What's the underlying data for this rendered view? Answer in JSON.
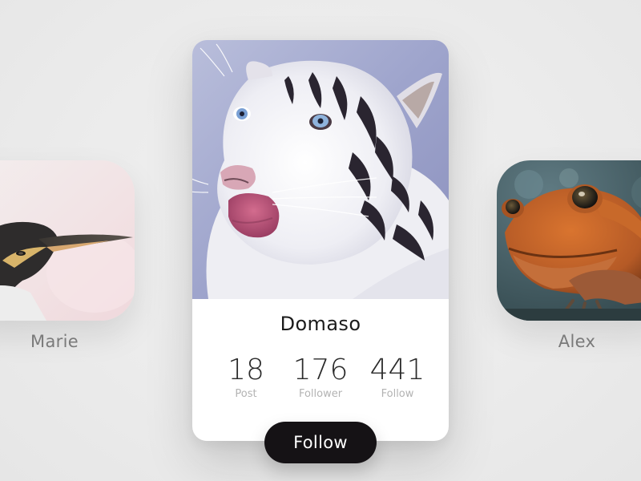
{
  "profiles": {
    "left": {
      "name": "Marie",
      "animal": "penguin-photo"
    },
    "center": {
      "name": "Domaso",
      "animal": "white-tiger-photo",
      "stats": [
        {
          "value": "18",
          "label": "Post"
        },
        {
          "value": "176",
          "label": "Follower"
        },
        {
          "value": "441",
          "label": "Follow"
        }
      ]
    },
    "right": {
      "name": "Alex",
      "animal": "frog-photo"
    }
  },
  "actions": {
    "follow_label": "Follow"
  },
  "colors": {
    "background": "#ececec",
    "card": "#ffffff",
    "button": "#151215",
    "button_text": "#ffffff",
    "name_text": "#1b1b1b",
    "side_name_text": "#7a7a7a",
    "stat_label": "#b3b3b3"
  }
}
